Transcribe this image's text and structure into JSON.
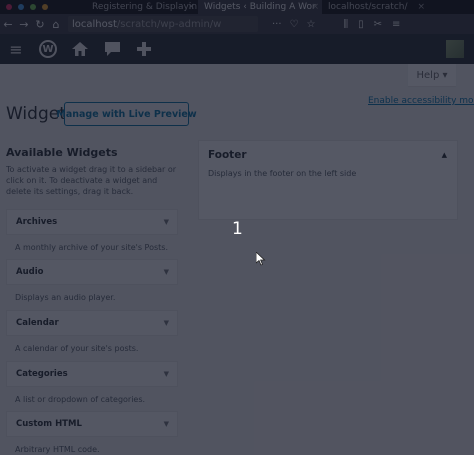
{
  "browser": {
    "tabs": [
      {
        "label": "Registering & Displayin",
        "active": false
      },
      {
        "label": "Widgets ‹ Building A Wor",
        "active": true
      },
      {
        "label": "localhost/scratch/",
        "active": false
      }
    ],
    "url_host": "localhost",
    "url_path": "/scratch/wp-admin/w",
    "nav": {
      "back": "←",
      "forward": "→",
      "reload": "↻",
      "home": "⌂"
    },
    "url_tools": {
      "more": "···",
      "bookmark": "♡",
      "star": "☆"
    }
  },
  "admin_bar": {
    "menu_icon": "menu-icon",
    "wp_logo_letter": "W",
    "home_icon": "home-icon",
    "comments_icon": "comment-icon",
    "new_icon": "plus-icon"
  },
  "help_tab": {
    "label": "Help ▾"
  },
  "accessibility_link": "Enable accessibility mode",
  "page": {
    "title": "Widgets",
    "live_preview_button": "Manage with Live Preview"
  },
  "available_widgets": {
    "title": "Available Widgets",
    "description": "To activate a widget drag it to a sidebar or click on it. To deactivate a widget and delete its settings, drag it back.",
    "items": [
      {
        "name": "Archives",
        "description": "A monthly archive of your site's Posts."
      },
      {
        "name": "Audio",
        "description": "Displays an audio player."
      },
      {
        "name": "Calendar",
        "description": "A calendar of your site's posts."
      },
      {
        "name": "Categories",
        "description": "A list or dropdown of categories."
      },
      {
        "name": "Custom HTML",
        "description": "Arbitrary HTML code."
      }
    ]
  },
  "sidebar": {
    "title": "Footer",
    "description": "Displays in the footer on the left side"
  },
  "annotation": {
    "step_number": "1"
  },
  "colors": {
    "admin_bar": "#23282d",
    "accent": "#0073aa",
    "overlay": "#141828"
  }
}
